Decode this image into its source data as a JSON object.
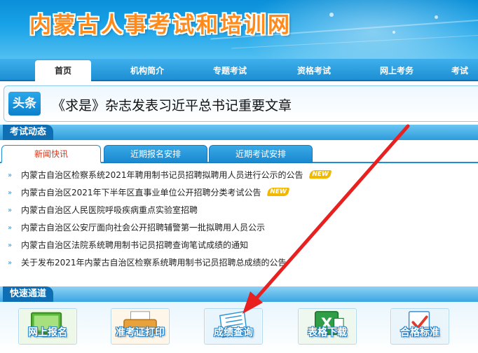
{
  "site": {
    "title": "内蒙古人事考试和培训网"
  },
  "nav": {
    "items": [
      {
        "label": "首页",
        "active": true
      },
      {
        "label": "机构简介",
        "active": false
      },
      {
        "label": "专题考试",
        "active": false
      },
      {
        "label": "资格考试",
        "active": false
      },
      {
        "label": "网上考务",
        "active": false
      },
      {
        "label": "考试",
        "active": false
      }
    ]
  },
  "headline": {
    "badge": "头条",
    "text": "《求是》杂志发表习近平总书记重要文章"
  },
  "exam_news": {
    "section_title": "考试动态",
    "tabs": [
      {
        "label": "新闻快讯",
        "active": true
      },
      {
        "label": "近期报名安排",
        "active": false
      },
      {
        "label": "近期考试安排",
        "active": false
      }
    ],
    "new_badge": "NEW",
    "items": [
      {
        "text": "内蒙古自治区检察系统2021年聘用制书记员招聘拟聘用人员进行公示的公告",
        "is_new": true
      },
      {
        "text": "内蒙古自治区2021年下半年区直事业单位公开招聘分类考试公告",
        "is_new": true
      },
      {
        "text": "内蒙古自治区人民医院呼吸疾病重点实验室招聘",
        "is_new": false
      },
      {
        "text": "内蒙古自治区公安厅面向社会公开招聘辅警第一批拟聘用人员公示",
        "is_new": false
      },
      {
        "text": "内蒙古自治区法院系统聘用制书记员招聘查询笔试成绩的通知",
        "is_new": false
      },
      {
        "text": "关于发布2021年内蒙古自治区检察系统聘用制书记员招聘总成绩的公告",
        "is_new": false
      }
    ]
  },
  "quick_access": {
    "section_title": "快速通道",
    "buttons": [
      {
        "label": "网上报名",
        "icon": "screen-icon"
      },
      {
        "label": "准考证打印",
        "icon": "printer-icon"
      },
      {
        "label": "成绩查询",
        "icon": "paper-icon"
      },
      {
        "label": "表格下载",
        "icon": "excel-icon"
      },
      {
        "label": "合格标准",
        "icon": "checkmark-icon"
      }
    ]
  },
  "colors": {
    "brand_blue": "#1d8fd3",
    "title_orange": "#ff8a1c",
    "annotation_red": "#e82020",
    "active_tab_red": "#d43a20"
  }
}
